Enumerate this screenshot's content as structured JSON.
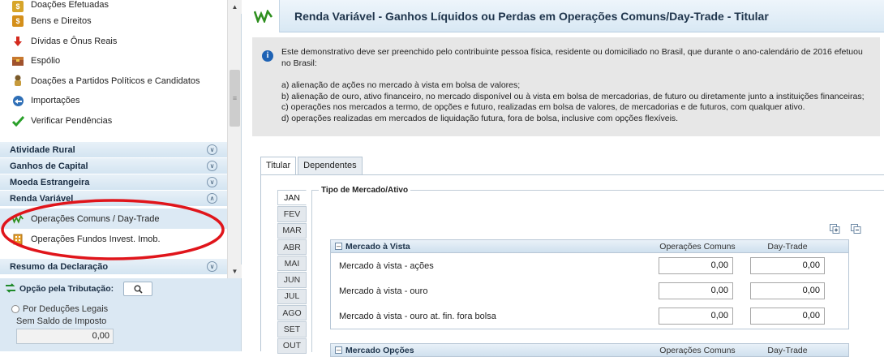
{
  "sidebar": {
    "items": [
      {
        "label": "Doações Efetuadas",
        "icon": "donation-icon"
      },
      {
        "label": "Bens e Direitos",
        "icon": "assets-icon"
      },
      {
        "label": "Dívidas e Ônus Reais",
        "icon": "debts-icon"
      },
      {
        "label": "Espólio",
        "icon": "estate-icon"
      },
      {
        "label": "Doações a Partidos Políticos e Candidatos",
        "icon": "party-donation-icon"
      },
      {
        "label": "Importações",
        "icon": "import-icon"
      },
      {
        "label": "Verificar Pendências",
        "icon": "check-icon"
      }
    ],
    "sections": [
      {
        "label": "Atividade Rural",
        "state": "collapsed"
      },
      {
        "label": "Ganhos de Capital",
        "state": "collapsed"
      },
      {
        "label": "Moeda Estrangeira",
        "state": "collapsed"
      },
      {
        "label": "Renda Variável",
        "state": "expanded"
      }
    ],
    "sub_items": [
      {
        "label": "Operações Comuns / Day-Trade",
        "icon": "stock-chart-icon"
      },
      {
        "label": "Operações Fundos Invest. Imob.",
        "icon": "building-icon"
      }
    ],
    "last_section": {
      "label": "Resumo da Declaração",
      "state": "collapsed"
    },
    "highlight_color": "#e0151b"
  },
  "opcao": {
    "label": "Opção pela Tributação:",
    "radio_label": "Por Deduções Legais",
    "saldo_label": "Sem Saldo de Imposto",
    "saldo_value": "0,00"
  },
  "main": {
    "title": "Renda Variável - Ganhos Líquidos ou Perdas em Operações Comuns/Day-Trade - Titular",
    "info": {
      "lead": "Este demonstrativo deve ser preenchido pelo contribuinte pessoa física, residente ou domiciliado no Brasil, que durante o ano-calendário de 2016 efetuou no Brasil:",
      "lines": [
        "a) alienação de ações no mercado à vista em bolsa de valores;",
        "b) alienação de ouro, ativo financeiro, no mercado disponível ou à vista em bolsa de mercadorias, de futuro ou diretamente junto a instituições financeiras;",
        "c) operações nos mercados a termo, de opções e futuro, realizadas em bolsa de valores, de mercadorias e de futuros, com qualquer ativo.",
        "d) operações realizadas em mercados de liquidação futura, fora de bolsa, inclusive com opções flexíveis."
      ]
    },
    "tabs": [
      "Titular",
      "Dependentes"
    ],
    "active_tab": "Titular",
    "months": [
      "JAN",
      "FEV",
      "MAR",
      "ABR",
      "MAI",
      "JUN",
      "JUL",
      "AGO",
      "SET",
      "OUT"
    ],
    "active_month": "JAN",
    "fieldset_legend": "Tipo de Mercado/Ativo",
    "col_headers": [
      "Operações Comuns",
      "Day-Trade"
    ],
    "group1": {
      "title": "Mercado à Vista",
      "rows": [
        {
          "label": "Mercado à vista - ações",
          "comuns": "0,00",
          "daytrade": "0,00"
        },
        {
          "label": "Mercado à vista - ouro",
          "comuns": "0,00",
          "daytrade": "0,00"
        },
        {
          "label": "Mercado à vista - ouro at. fin. fora bolsa",
          "comuns": "0,00",
          "daytrade": "0,00"
        }
      ]
    },
    "group2": {
      "title": "Mercado Opções"
    }
  }
}
